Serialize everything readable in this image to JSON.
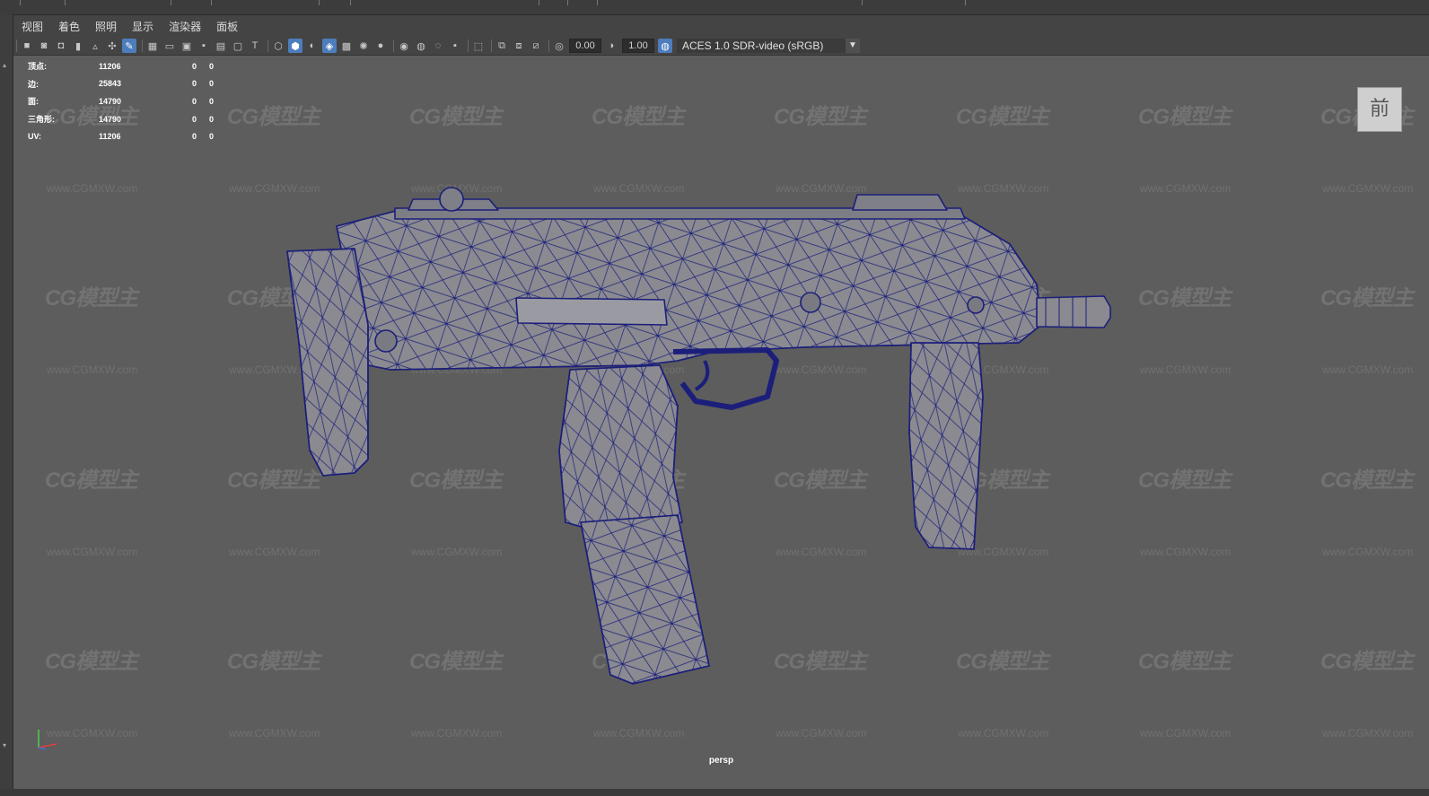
{
  "menubar": {
    "items": [
      "视图",
      "着色",
      "照明",
      "显示",
      "渲染器",
      "面板"
    ]
  },
  "toolbar": {
    "icons": [
      "camera-icon",
      "lock-camera-icon",
      "camera-attributes-icon",
      "bookmark-icon",
      "image-plane-icon",
      "2d-pan-zoom-icon",
      "grease-pencil-icon",
      "grid-icon",
      "film-gate-icon",
      "resolution-gate-icon",
      "gate-mask-icon",
      "field-chart-icon",
      "safe-action-icon",
      "safe-title-icon",
      "wireframe-icon",
      "smooth-shade-icon",
      "use-default-material-icon",
      "wireframe-on-shaded-icon",
      "xray-icon",
      "use-all-lights-icon",
      "shadows-icon",
      "screen-space-ao-icon",
      "motion-blur-icon",
      "anti-aliasing-icon",
      "depth-of-field-icon",
      "isolate-select-icon",
      "xray-joints-icon",
      "xray-active-components-icon",
      "exposure-icon",
      "gamma-icon",
      "color-management-icon"
    ],
    "exposure_value": "0.00",
    "gamma_value": "1.00",
    "color_space": "ACES 1.0 SDR-video (sRGB)"
  },
  "hud": {
    "rows": [
      {
        "label": "顶点:",
        "v1": "11206",
        "v2": "0",
        "v3": "0"
      },
      {
        "label": "边:",
        "v1": "25843",
        "v2": "0",
        "v3": "0"
      },
      {
        "label": "面:",
        "v1": "14790",
        "v2": "0",
        "v3": "0"
      },
      {
        "label": "三角形:",
        "v1": "14790",
        "v2": "0",
        "v3": "0"
      },
      {
        "label": "UV:",
        "v1": "11206",
        "v2": "0",
        "v3": "0"
      }
    ]
  },
  "watermark": {
    "logo": "CG模型主",
    "url": "www.CGMXW.com"
  },
  "viewcube": {
    "face": "前"
  },
  "viewport": {
    "camera": "persp"
  },
  "colors": {
    "viewport_bg": "#5d5d5d",
    "wire": "#1c1f7a",
    "mesh_fill": "#8a8a90",
    "active_icon": "#4d7dbd"
  }
}
